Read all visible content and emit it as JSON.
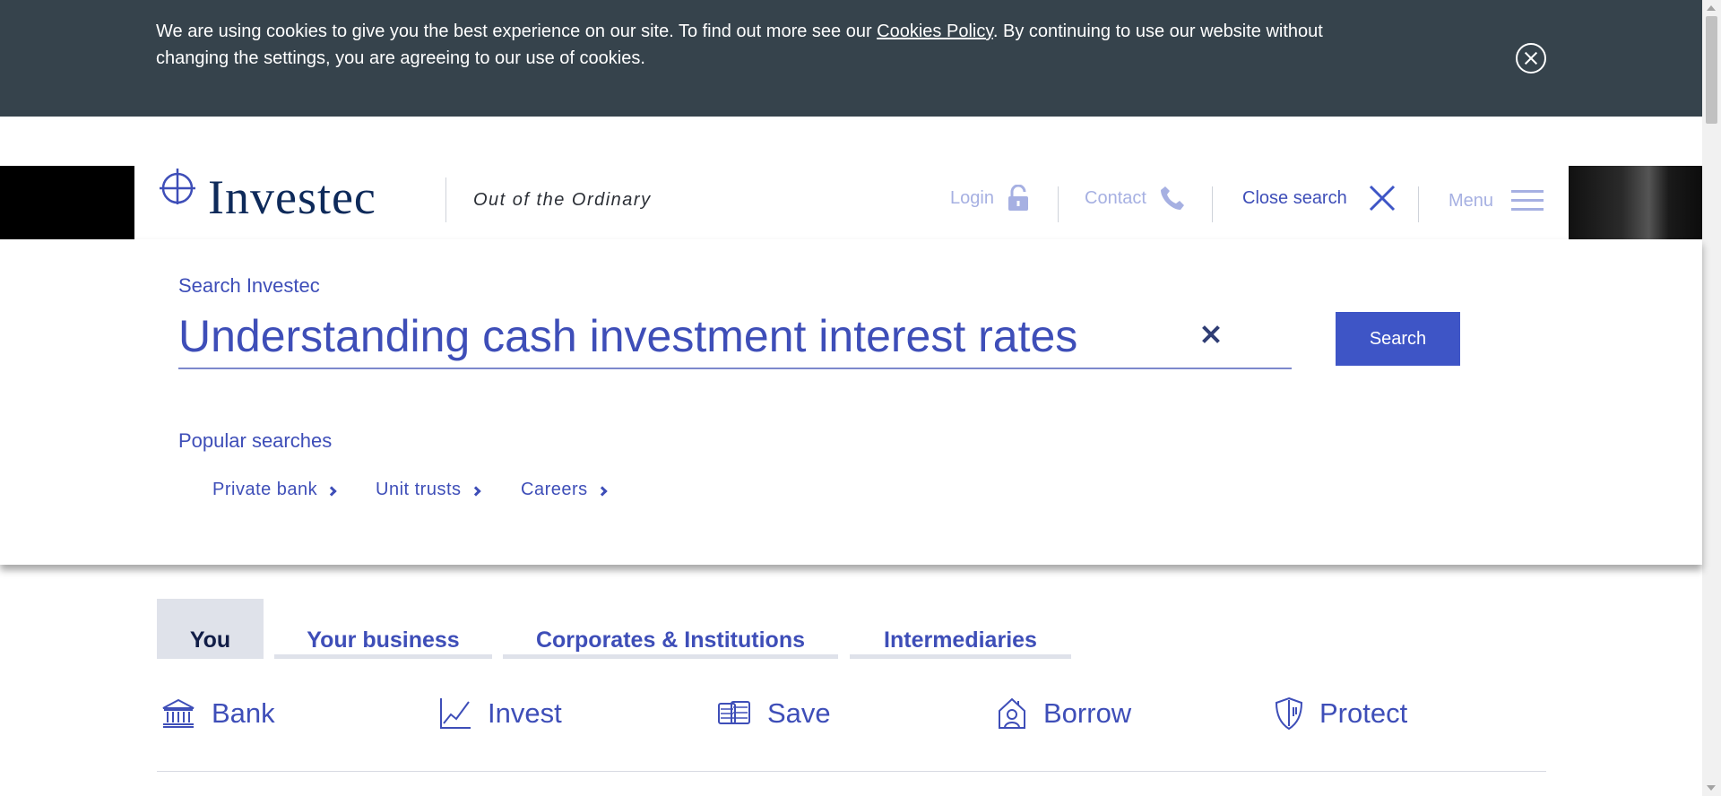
{
  "cookie_banner": {
    "text_before": "We are using cookies to give you the best experience on our site. To find out more see our ",
    "link_text": "Cookies Policy",
    "text_after": ". By continuing to use our website without changing the settings, you are agreeing to our use of cookies."
  },
  "header": {
    "logo_text": "Investec",
    "tagline": "Out of the Ordinary",
    "login_label": "Login",
    "contact_label": "Contact",
    "close_search_label": "Close search",
    "menu_label": "Menu"
  },
  "search": {
    "label": "Search Investec",
    "value": "Understanding cash investment interest rates",
    "button_label": "Search",
    "popular_label": "Popular searches",
    "popular": [
      "Private bank",
      "Unit trusts",
      "Careers"
    ]
  },
  "tabs": [
    "You",
    "Your business",
    "Corporates & Institutions",
    "Intermediaries"
  ],
  "active_tab": "You",
  "categories": [
    {
      "label": "Bank",
      "icon": "bank-icon"
    },
    {
      "label": "Invest",
      "icon": "chart-icon"
    },
    {
      "label": "Save",
      "icon": "coins-icon"
    },
    {
      "label": "Borrow",
      "icon": "house-icon"
    },
    {
      "label": "Protect",
      "icon": "shield-icon"
    }
  ],
  "colors": {
    "banner_bg": "#36434c",
    "brand_blue": "#3e4eb8",
    "button_blue": "#3e55c6",
    "navy": "#0e2a5a",
    "tab_active_bg": "#dfe2ea"
  }
}
